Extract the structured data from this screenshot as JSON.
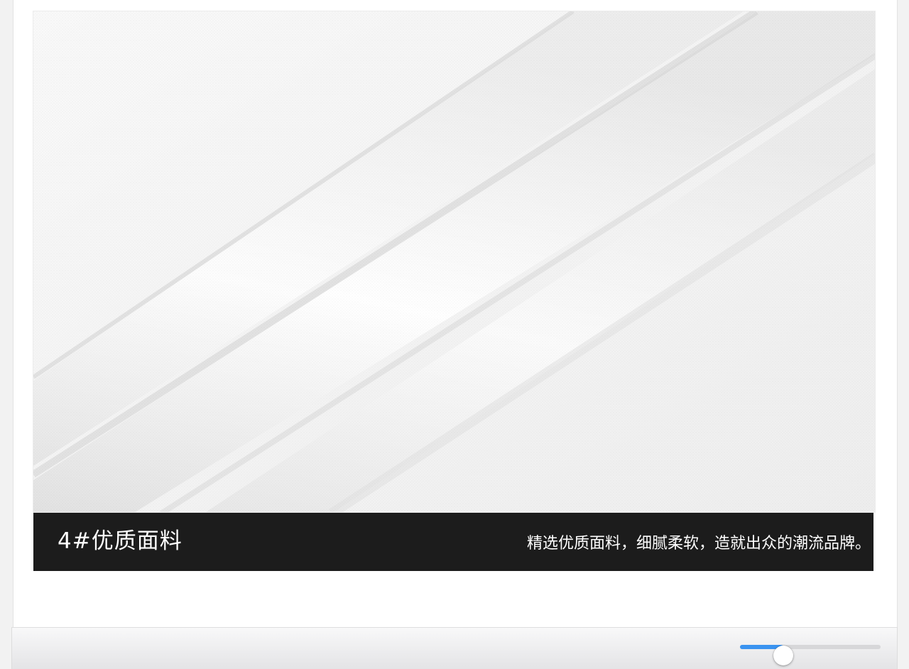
{
  "feature": {
    "title": "4#优质面料",
    "description": "精选优质面料，细腻柔软，造就出众的潮流品牌。"
  },
  "image": {
    "subject": "fabric-photo"
  },
  "zoom_slider": {
    "value": 0.31,
    "accent_color": "#3a93f0",
    "track_color": "#d7d7d9"
  },
  "colors": {
    "caption_bg": "#1c1c1c",
    "caption_text": "#ffffff"
  }
}
